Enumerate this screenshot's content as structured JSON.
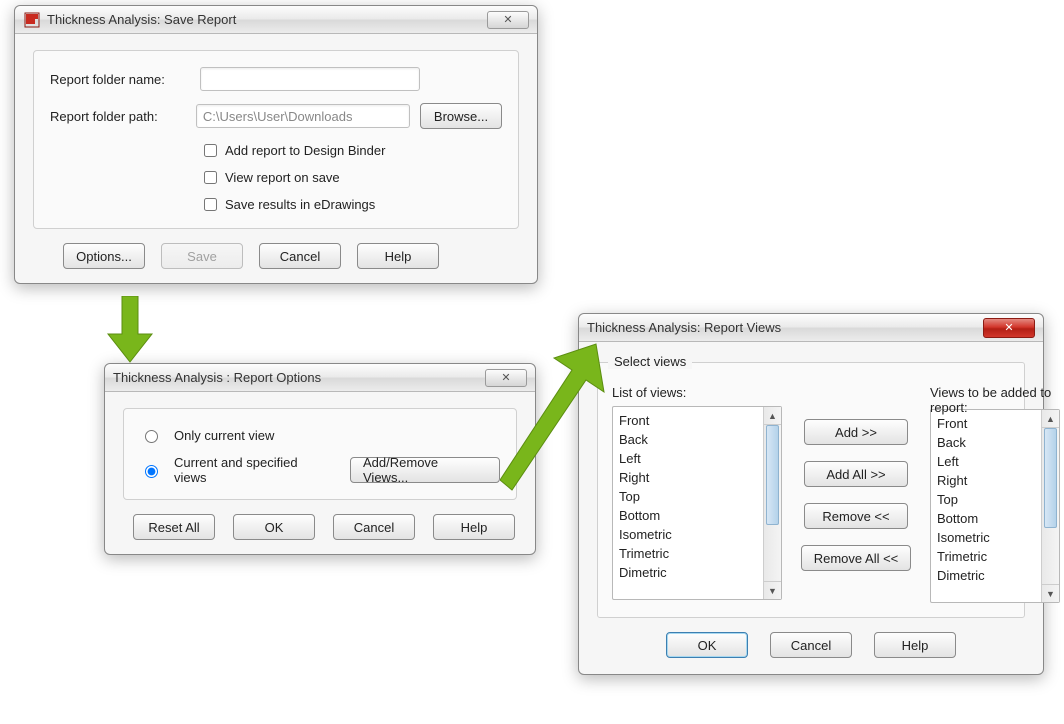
{
  "dialog1": {
    "title": "Thickness Analysis: Save Report",
    "folder_name_label": "Report folder name:",
    "folder_name_value": "",
    "folder_path_label": "Report folder path:",
    "folder_path_value": "C:\\Users\\User\\Downloads",
    "browse": "Browse...",
    "chk_binder": "Add report to Design Binder",
    "chk_view": "View report on save",
    "chk_edraw": "Save results in eDrawings",
    "options": "Options...",
    "save": "Save",
    "cancel": "Cancel",
    "help": "Help"
  },
  "dialog2": {
    "title": "Thickness Analysis : Report Options",
    "radio_current": "Only current view",
    "radio_specified": "Current and specified views",
    "addremove": "Add/Remove Views...",
    "reset": "Reset All",
    "ok": "OK",
    "cancel": "Cancel",
    "help": "Help"
  },
  "dialog3": {
    "title": "Thickness Analysis: Report Views",
    "legend": "Select views",
    "list_label": "List of views:",
    "added_label": "Views to be added to report:",
    "views": [
      "Front",
      "Back",
      "Left",
      "Right",
      "Top",
      "Bottom",
      "Isometric",
      "Trimetric",
      "Dimetric"
    ],
    "add": "Add >>",
    "addall": "Add All >>",
    "remove": "Remove <<",
    "removeall": "Remove All <<",
    "ok": "OK",
    "cancel": "Cancel",
    "help": "Help"
  }
}
